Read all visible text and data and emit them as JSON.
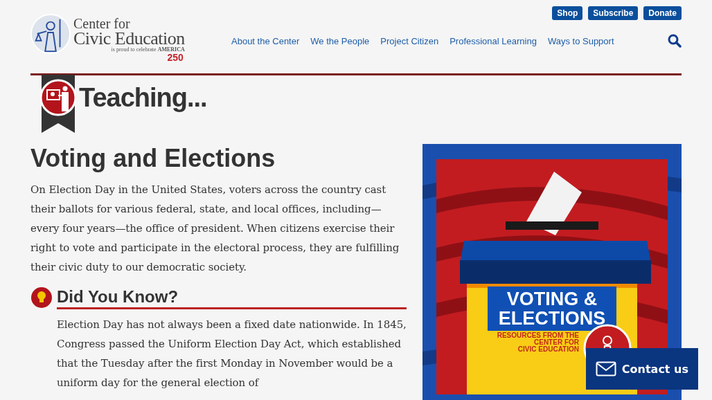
{
  "logo": {
    "line_1": "Center for",
    "line_2": "Civic Education",
    "tagline": "is proud to celebrate",
    "tagline_brand": "AMERICA",
    "anniversary": "250"
  },
  "utility_buttons": [
    "Shop",
    "Subscribe",
    "Donate"
  ],
  "nav": [
    "About the Center",
    "We the People",
    "Project Citizen",
    "Professional Learning",
    "Ways to Support"
  ],
  "banner": {
    "title": "Teaching..."
  },
  "article": {
    "title": "Voting and Elections",
    "intro": "On Election Day in the United States, voters across the country cast their ballots for various federal, state, and local offices, including—every four years—the office of president. When citizens exercise their right to vote and participate in the electoral process, they are fulfilling their civic duty to our democratic society."
  },
  "did_you_know": {
    "title": "Did You Know?",
    "text": "Election Day has not always been a fixed date nationwide. In 1845, Congress passed the Uniform Election Day Act, which established that the Tuesday after the first Monday in November would be a uniform day for the general election of"
  },
  "illustration": {
    "title_1": "VOTING &",
    "title_2": "ELECTIONS",
    "caption": [
      "RESOURCES FROM THE",
      "CENTER FOR",
      "CIVIC EDUCATION"
    ]
  },
  "contact_button": "Contact us"
}
